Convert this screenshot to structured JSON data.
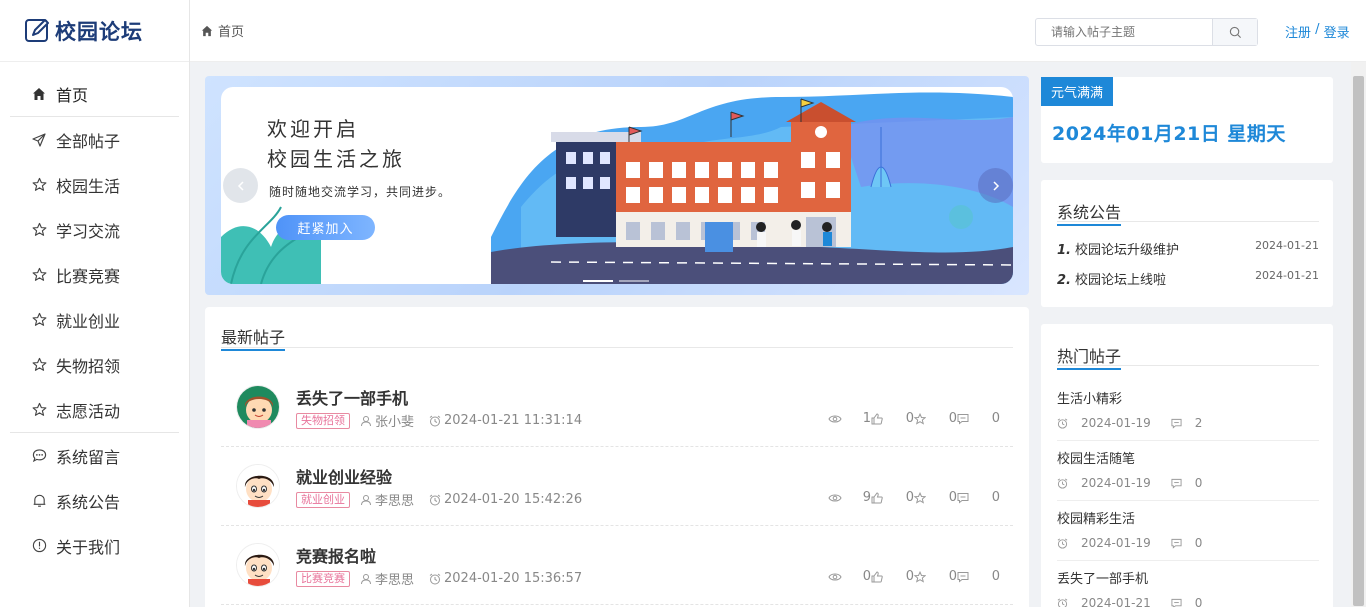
{
  "app": {
    "logo_text": "校园论坛"
  },
  "sidebar": {
    "items": [
      {
        "label": "首页",
        "icon": "home-icon",
        "name": "home"
      },
      {
        "label": "全部帖子",
        "icon": "send-icon",
        "name": "all-posts"
      },
      {
        "label": "校园生活",
        "icon": "star-icon",
        "name": "campus-life"
      },
      {
        "label": "学习交流",
        "icon": "star-icon",
        "name": "study"
      },
      {
        "label": "比赛竞赛",
        "icon": "star-icon",
        "name": "competition"
      },
      {
        "label": "就业创业",
        "icon": "star-icon",
        "name": "career"
      },
      {
        "label": "失物招领",
        "icon": "star-icon",
        "name": "lost-found"
      },
      {
        "label": "志愿活动",
        "icon": "star-icon",
        "name": "volunteer"
      },
      {
        "label": "系统留言",
        "icon": "chat-icon",
        "name": "messages"
      },
      {
        "label": "系统公告",
        "icon": "bell-icon",
        "name": "announcements"
      },
      {
        "label": "关于我们",
        "icon": "info-icon",
        "name": "about"
      }
    ]
  },
  "header": {
    "breadcrumb": "首页",
    "search_placeholder": "请输入帖子主题",
    "register": "注册",
    "separator": " / ",
    "login": "登录"
  },
  "banner": {
    "title_line1": "欢迎开启",
    "title_line2": "校园生活之旅",
    "subtitle": "随时随地交流学习，共同进步。",
    "button": "赶紧加入"
  },
  "latest": {
    "title": "最新帖子",
    "posts": [
      {
        "title": "丢失了一部手机",
        "tag": "失物招领",
        "author": "张小斐",
        "time": "2024-01-21 11:31:14",
        "views": "1",
        "likes": "0",
        "favs": "0",
        "comments": "0"
      },
      {
        "title": "就业创业经验",
        "tag": "就业创业",
        "author": "李思思",
        "time": "2024-01-20 15:42:26",
        "views": "9",
        "likes": "0",
        "favs": "0",
        "comments": "0"
      },
      {
        "title": "竞赛报名啦",
        "tag": "比赛竞赛",
        "author": "李思思",
        "time": "2024-01-20 15:36:57",
        "views": "0",
        "likes": "0",
        "favs": "0",
        "comments": "0"
      }
    ]
  },
  "date_card": {
    "tag": "元气满满",
    "date": "2024年01月21日 星期天"
  },
  "notices": {
    "title": "系统公告",
    "items": [
      {
        "num": "1.",
        "text": "校园论坛升级维护",
        "date": "2024-01-21"
      },
      {
        "num": "2.",
        "text": "校园论坛上线啦",
        "date": "2024-01-21"
      }
    ]
  },
  "hot": {
    "title": "热门帖子",
    "items": [
      {
        "title": "生活小精彩",
        "date": "2024-01-19",
        "comments": "2"
      },
      {
        "title": "校园生活随笔",
        "date": "2024-01-19",
        "comments": "0"
      },
      {
        "title": "校园精彩生活",
        "date": "2024-01-19",
        "comments": "0"
      },
      {
        "title": "丢失了一部手机",
        "date": "2024-01-21",
        "comments": "0"
      }
    ]
  },
  "colors": {
    "accent": "#1e88d8",
    "tag_pink": "#e8739a",
    "logo_navy": "#1d3c78"
  }
}
